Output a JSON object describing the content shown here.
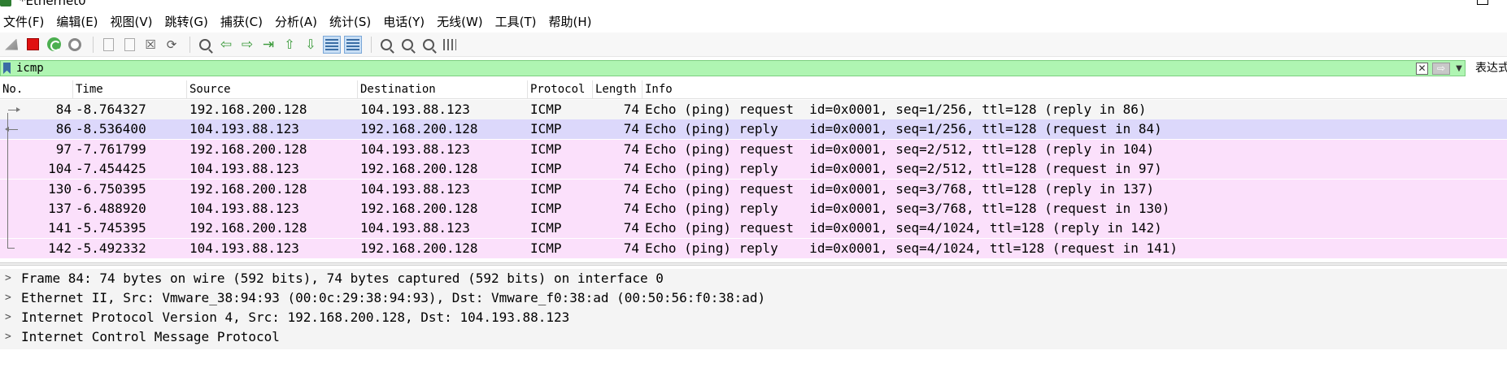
{
  "window": {
    "title": "*Ethernet0"
  },
  "menu": [
    {
      "label": "文件(F)"
    },
    {
      "label": "编辑(E)"
    },
    {
      "label": "视图(V)"
    },
    {
      "label": "跳转(G)"
    },
    {
      "label": "捕获(C)"
    },
    {
      "label": "分析(A)"
    },
    {
      "label": "统计(S)"
    },
    {
      "label": "电话(Y)"
    },
    {
      "label": "无线(W)"
    },
    {
      "label": "工具(T)"
    },
    {
      "label": "帮助(H)"
    }
  ],
  "toolbar_icons": [
    "start-capture-icon",
    "stop-capture-icon",
    "restart-capture-icon",
    "capture-options-icon",
    "open-file-icon",
    "save-file-icon",
    "close-file-icon",
    "reload-file-icon",
    "find-packet-icon",
    "go-back-icon",
    "go-forward-icon",
    "go-to-packet-icon",
    "first-packet-icon",
    "last-packet-icon",
    "auto-scroll-icon",
    "colorize-icon",
    "zoom-in-icon",
    "zoom-out-icon",
    "normal-size-icon",
    "resize-columns-icon"
  ],
  "filter": {
    "value": "icmp",
    "expression_label": "表达式",
    "background_color": "#aff5b2"
  },
  "packet_list": {
    "columns": [
      "No.",
      "Time",
      "Source",
      "Destination",
      "Protocol",
      "Length",
      "Info"
    ],
    "rows": [
      {
        "no": "84",
        "time": "-8.764327",
        "source": "192.168.200.128",
        "destination": "104.193.88.123",
        "protocol": "ICMP",
        "length": "74",
        "info": "Echo (ping) request  id=0x0001, seq=1/256, ttl=128 (reply in 86)"
      },
      {
        "no": "86",
        "time": "-8.536400",
        "source": "104.193.88.123",
        "destination": "192.168.200.128",
        "protocol": "ICMP",
        "length": "74",
        "info": "Echo (ping) reply    id=0x0001, seq=1/256, ttl=128 (request in 84)"
      },
      {
        "no": "97",
        "time": "-7.761799",
        "source": "192.168.200.128",
        "destination": "104.193.88.123",
        "protocol": "ICMP",
        "length": "74",
        "info": "Echo (ping) request  id=0x0001, seq=2/512, ttl=128 (reply in 104)"
      },
      {
        "no": "104",
        "time": "-7.454425",
        "source": "104.193.88.123",
        "destination": "192.168.200.128",
        "protocol": "ICMP",
        "length": "74",
        "info": "Echo (ping) reply    id=0x0001, seq=2/512, ttl=128 (request in 97)"
      },
      {
        "no": "130",
        "time": "-6.750395",
        "source": "192.168.200.128",
        "destination": "104.193.88.123",
        "protocol": "ICMP",
        "length": "74",
        "info": "Echo (ping) request  id=0x0001, seq=3/768, ttl=128 (reply in 137)"
      },
      {
        "no": "137",
        "time": "-6.488920",
        "source": "104.193.88.123",
        "destination": "192.168.200.128",
        "protocol": "ICMP",
        "length": "74",
        "info": "Echo (ping) reply    id=0x0001, seq=3/768, ttl=128 (request in 130)"
      },
      {
        "no": "141",
        "time": "-5.745395",
        "source": "192.168.200.128",
        "destination": "104.193.88.123",
        "protocol": "ICMP",
        "length": "74",
        "info": "Echo (ping) request  id=0x0001, seq=4/1024, ttl=128 (reply in 142)"
      },
      {
        "no": "142",
        "time": "-5.492332",
        "source": "104.193.88.123",
        "destination": "192.168.200.128",
        "protocol": "ICMP",
        "length": "74",
        "info": "Echo (ping) reply    id=0x0001, seq=4/1024, ttl=128 (request in 141)"
      }
    ],
    "row_colors": {
      "icmp": "#fbe0fb",
      "first": "#f5f5f5",
      "selected": "#dcd8fb"
    }
  },
  "details": [
    {
      "text": "Frame 84: 74 bytes on wire (592 bits), 74 bytes captured (592 bits) on interface 0"
    },
    {
      "text": "Ethernet II, Src: Vmware_38:94:93 (00:0c:29:38:94:93), Dst: Vmware_f0:38:ad (00:50:56:f0:38:ad)"
    },
    {
      "text": "Internet Protocol Version 4, Src: 192.168.200.128, Dst: 104.193.88.123"
    },
    {
      "text": "Internet Control Message Protocol"
    }
  ]
}
